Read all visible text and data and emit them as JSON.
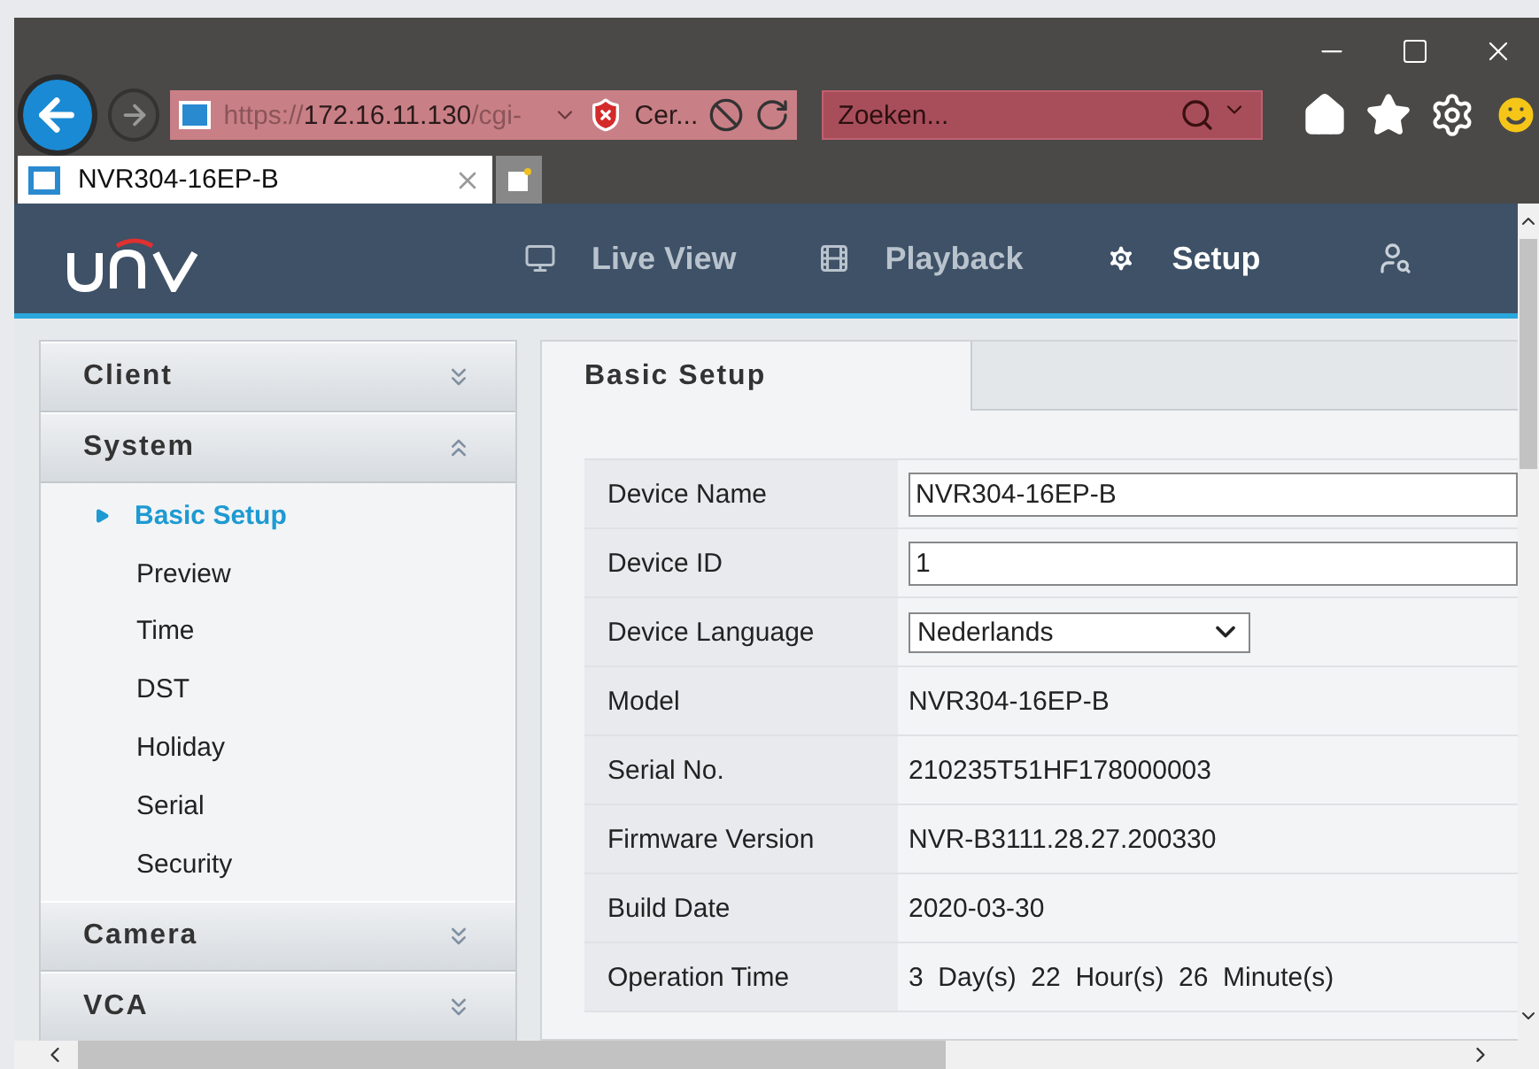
{
  "address_bar": {
    "url": {
      "scheme": "https://",
      "host": "172.16.11.130",
      "path": "/cgi-"
    },
    "certificate": "Cer..."
  },
  "search": {
    "placeholder": "Zoeken..."
  },
  "browser_tabs": [
    {
      "label": "NVR304-16EP-B",
      "selected": true
    }
  ],
  "nav": [
    {
      "label": "Live View",
      "selected": false
    },
    {
      "label": "Playback",
      "selected": false
    },
    {
      "label": "Setup",
      "selected": true
    }
  ],
  "sidebar": [
    {
      "label": "Client",
      "expanded": false
    },
    {
      "label": "System",
      "expanded": true,
      "children": [
        {
          "label": "Basic Setup",
          "selected": true
        },
        {
          "label": "Preview",
          "selected": false
        },
        {
          "label": "Time",
          "selected": false
        },
        {
          "label": "DST",
          "selected": false
        },
        {
          "label": "Holiday",
          "selected": false
        },
        {
          "label": "Serial",
          "selected": false
        },
        {
          "label": "Security",
          "selected": false
        }
      ]
    },
    {
      "label": "Camera",
      "expanded": false
    },
    {
      "label": "VCA",
      "expanded": false
    }
  ],
  "content_tabs": [
    {
      "label": "Basic Setup",
      "selected": true
    }
  ],
  "form": [
    {
      "label": "Device Name",
      "kind": "input",
      "value": "NVR304-16EP-B"
    },
    {
      "label": "Device ID",
      "kind": "input",
      "value": "1"
    },
    {
      "label": "Device Language",
      "kind": "select",
      "value": "Nederlands"
    },
    {
      "label": "Model",
      "kind": "text",
      "value": "NVR304-16EP-B"
    },
    {
      "label": "Serial No.",
      "kind": "text",
      "value": "210235T51HF178000003"
    },
    {
      "label": "Firmware Version",
      "kind": "text",
      "value": "NVR-B3111.28.27.200330"
    },
    {
      "label": "Build Date",
      "kind": "text",
      "value": "2020-03-30"
    },
    {
      "label": "Operation Time",
      "kind": "text",
      "value": "3  Day(s)  22  Hour(s)  26  Minute(s)"
    }
  ]
}
